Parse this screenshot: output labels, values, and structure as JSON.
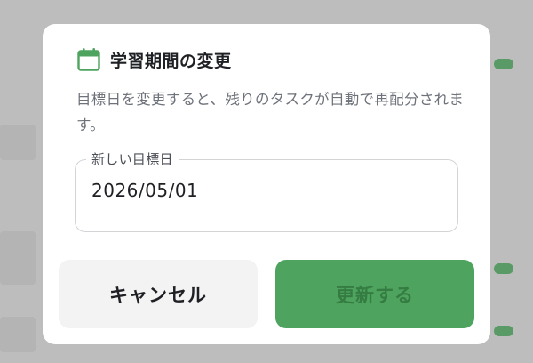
{
  "dialog": {
    "title": "学習期間の変更",
    "description": "目標日を変更すると、残りのタスクが自動で再配分されます。",
    "date_field": {
      "label": "新しい目標日",
      "value": "2026/05/01"
    },
    "buttons": {
      "cancel_label": "キャンセル",
      "update_label": "更新する"
    }
  },
  "colors": {
    "accent": "#4ea45f",
    "update_text": "#357c42",
    "cancel_bg": "#f3f3f4",
    "overlay": "#bdbdbd"
  },
  "icons": {
    "title_icon": "calendar-icon"
  }
}
